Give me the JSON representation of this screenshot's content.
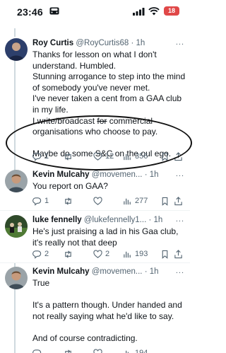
{
  "status_bar": {
    "time": "23:46",
    "battery": "18"
  },
  "tweets": [
    {
      "name": "Roy Curtis",
      "handle": "@RoyCurtis68",
      "time": "· 1h",
      "more": "...",
      "p1": "Thanks for lesson on what I don't understand. Humbled.",
      "p2": "Stunning arrogance to step into the mind of somebody you've never met.",
      "p3": "I've never taken a cent from a GAA club in my life.",
      "p4_before": "I write/broadcast ",
      "p4_strike": "for",
      "p4_after": " commercial organisations who choose to pay.",
      "p5": "Maybe do some S&C on the oul ego.",
      "replies": "1",
      "retweets": "",
      "likes": "12",
      "views": "356"
    },
    {
      "name": "Kevin Mulcahy",
      "handle": "@movemen...",
      "time": "· 1h",
      "more": "...",
      "text": "You report on GAA?",
      "replies": "1",
      "retweets": "",
      "likes": "",
      "views": "277"
    },
    {
      "name": "luke fennelly",
      "handle": "@lukefennelly1...",
      "time": "· 1h",
      "more": "...",
      "text": "He's just praising a lad in his Gaa club, it's really not that deep",
      "replies": "2",
      "retweets": "",
      "likes": "2",
      "views": "193"
    },
    {
      "name": "Kevin Mulcahy",
      "handle": "@movemen...",
      "time": "· 1h",
      "more": "...",
      "p1": "True",
      "p2": "It's a pattern though. Under handed and not really saying what he'd like to say.",
      "p3": "And of course contradicting.",
      "views": "194"
    }
  ],
  "colors": {
    "accent": "#1d9bf0",
    "muted": "#536471",
    "text": "#0f1419"
  },
  "icons": [
    "reply-icon",
    "retweet-icon",
    "like-icon",
    "views-icon",
    "bookmark-icon",
    "share-icon",
    "wifi-icon",
    "signal-icon",
    "car-icon"
  ]
}
